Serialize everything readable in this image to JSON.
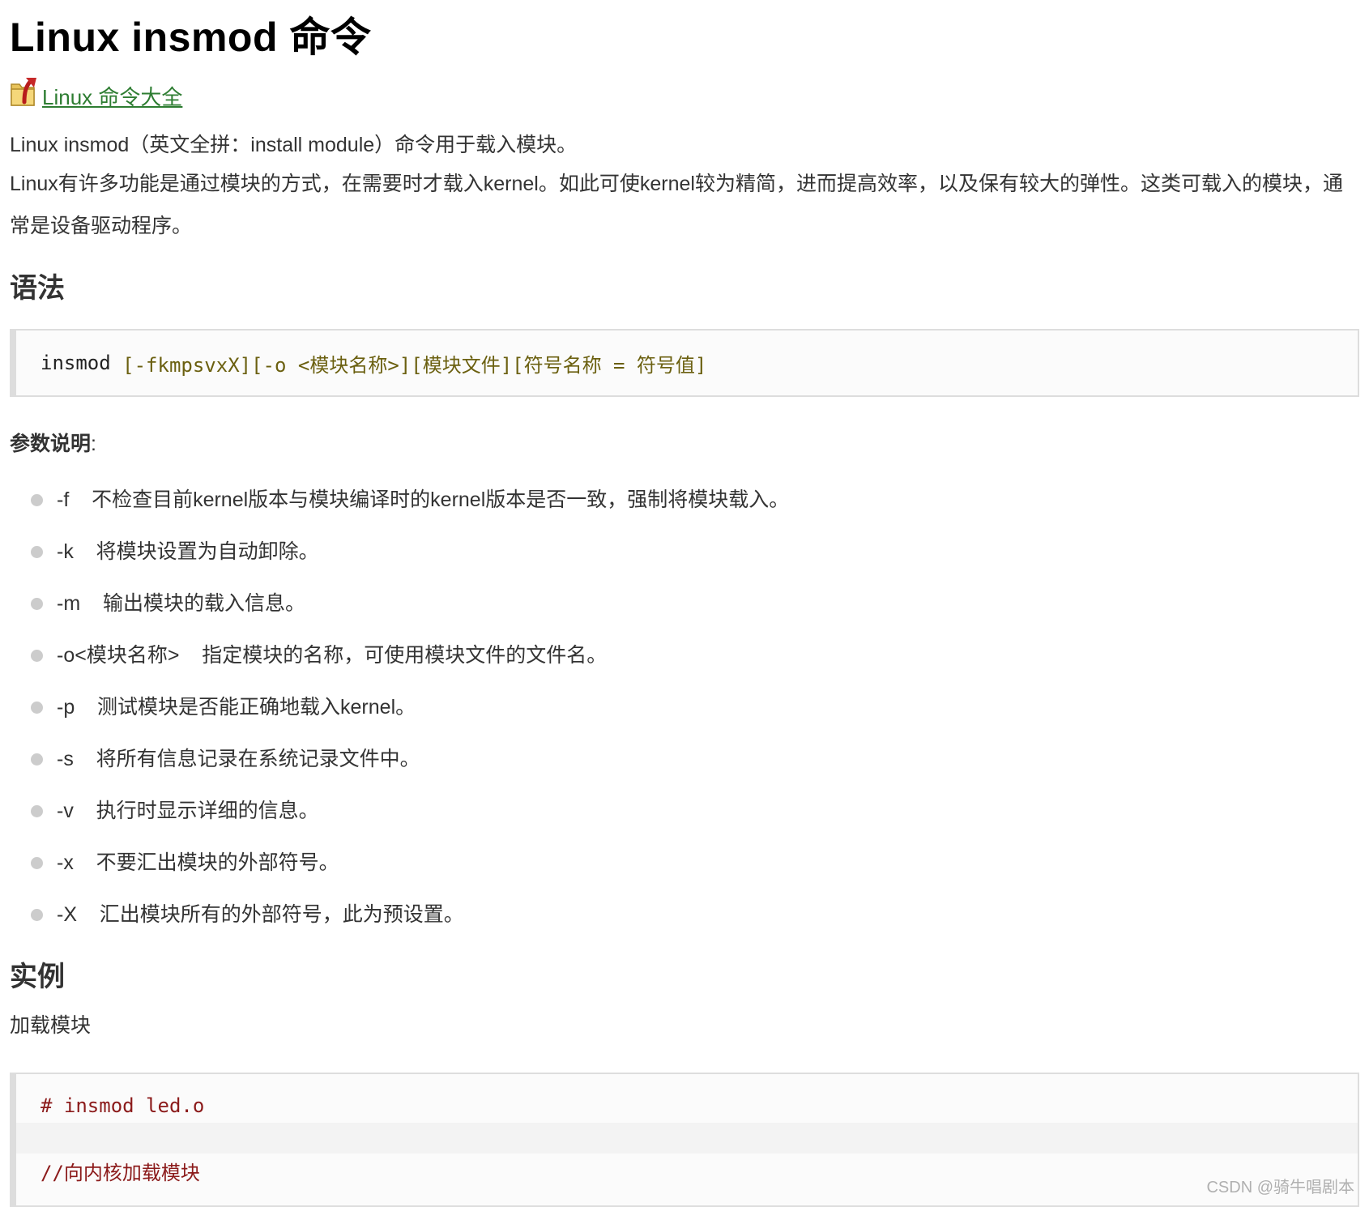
{
  "page_title": "Linux insmod 命令",
  "back_link": {
    "label": " Linux 命令大全",
    "icon": "folder-up-arrow-icon"
  },
  "intro_1": "Linux insmod（英文全拼：install module）命令用于载入模块。",
  "intro_2": "Linux有许多功能是通过模块的方式，在需要时才载入kernel。如此可使kernel较为精简，进而提高效率，以及保有较大的弹性。这类可载入的模块，通常是设备驱动程序。",
  "syntax": {
    "heading": "语法",
    "code_cmd": "insmod",
    "code_opts": "[-fkmpsvxX][-o <模块名称>][模块文件][符号名称 = 符号值]"
  },
  "params": {
    "label": "参数说明",
    "colon": ":",
    "items": [
      {
        "flag": "-f",
        "desc": "不检查目前kernel版本与模块编译时的kernel版本是否一致，强制将模块载入。"
      },
      {
        "flag": "-k",
        "desc": "将模块设置为自动卸除。"
      },
      {
        "flag": "-m",
        "desc": "输出模块的载入信息。"
      },
      {
        "flag": "-o<模块名称>",
        "desc": "指定模块的名称，可使用模块文件的文件名。"
      },
      {
        "flag": "-p",
        "desc": "测试模块是否能正确地载入kernel。"
      },
      {
        "flag": "-s",
        "desc": "将所有信息记录在系统记录文件中。"
      },
      {
        "flag": "-v",
        "desc": "执行时显示详细的信息。"
      },
      {
        "flag": "-x",
        "desc": "不要汇出模块的外部符号。"
      },
      {
        "flag": "-X",
        "desc": "汇出模块所有的外部符号，此为预设置。"
      }
    ]
  },
  "examples": {
    "heading": "实例",
    "subtitle": "加载模块",
    "code_line_1": "# insmod led.o",
    "code_line_2": "//向内核加载模块"
  },
  "watermark": "CSDN @骑牛唱剧本"
}
